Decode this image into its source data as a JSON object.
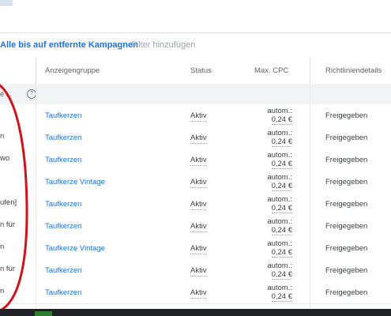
{
  "filters": {
    "active_filter": "Alle bis auf entfernte Kampagnen",
    "add_filter": "Filter hinzufügen"
  },
  "table": {
    "headers": {
      "adgroup": "Anzeigengruppe",
      "status": "Status",
      "max_cpc": "Max. CPC",
      "policy": "Richtliniendetails"
    },
    "summary": {
      "text": "e ...",
      "help_icon": "?"
    },
    "rows": [
      {
        "left": "",
        "adgroup": "Taufkerzen",
        "status": "Aktiv",
        "cpc_line1": "autom.:",
        "cpc_line2": "0,24 €",
        "policy": "Freigegeben"
      },
      {
        "left": "n",
        "adgroup": "Taufkerzen",
        "status": "Aktiv",
        "cpc_line1": "autom.:",
        "cpc_line2": "0,24 €",
        "policy": "Freigegeben"
      },
      {
        "left": "wo",
        "adgroup": "Taufkerzen",
        "status": "Aktiv",
        "cpc_line1": "autom.:",
        "cpc_line2": "0,24 €",
        "policy": "Freigegeben"
      },
      {
        "left": "",
        "adgroup": "Taufkerze Vintage",
        "status": "Aktiv",
        "cpc_line1": "autom.:",
        "cpc_line2": "0,24 €",
        "policy": "Freigegeben"
      },
      {
        "left": "ufen]",
        "adgroup": "Taufkerzen",
        "status": "Aktiv",
        "cpc_line1": "autom.:",
        "cpc_line2": "0,24 €",
        "policy": "Freigegeben"
      },
      {
        "left": "n für",
        "adgroup": "Taufkerzen",
        "status": "Aktiv",
        "cpc_line1": "autom.:",
        "cpc_line2": "0,24 €",
        "policy": "Freigegeben"
      },
      {
        "left": "n",
        "adgroup": "Taufkerze Vintage",
        "status": "Aktiv",
        "cpc_line1": "autom.:",
        "cpc_line2": "0,24 €",
        "policy": "Freigegeben"
      },
      {
        "left": "n für",
        "adgroup": "Taufkerzen",
        "status": "Aktiv",
        "cpc_line1": "autom.:",
        "cpc_line2": "0,24 €",
        "policy": "Freigegeben"
      },
      {
        "left": "n",
        "adgroup": "Taufkerzen",
        "status": "Aktiv",
        "cpc_line1": "autom.:",
        "cpc_line2": "0,24 €",
        "policy": "Freigegeben"
      }
    ]
  },
  "colors": {
    "link": "#1a73e8",
    "annotation": "#d0121b"
  }
}
